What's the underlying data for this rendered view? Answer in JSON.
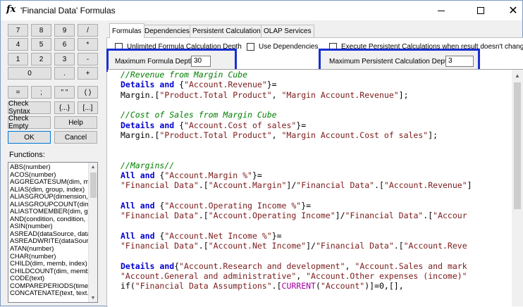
{
  "window": {
    "icon": "fx",
    "title": "'Financial Data' Formulas",
    "min_symbol": "",
    "close_symbol": "✕"
  },
  "keypad": {
    "row1": [
      "7",
      "8",
      "9",
      "/"
    ],
    "row2": [
      "4",
      "5",
      "6",
      "*"
    ],
    "row3": [
      "1",
      "2",
      "3",
      "-"
    ],
    "row4": [
      "0",
      ".",
      "+"
    ],
    "row5": [
      "=",
      ";",
      "\" \"",
      "( )"
    ],
    "check_syntax": "Check Syntax",
    "braces": "{...}",
    "brackets": "[...]",
    "check_empty": "Check Empty",
    "help": "Help",
    "ok": "OK",
    "cancel": "Cancel"
  },
  "functions": {
    "label": "Functions:",
    "items": [
      "ABS(number)",
      "ACOS(number)",
      "AGGREGATESUM(dim, me",
      "ALIAS(dim, group, index)",
      "ALIASGROUP(dimension, i",
      "ALIASGROUPCOUNT(dim",
      "ALIASTOMEMBER(dim, gr",
      "AND(condition, condition, .",
      "ASIN(number)",
      "ASREAD(dataSource, data",
      "ASREADWRITE(dataSourc",
      "ATAN(number)",
      "CHAR(number)",
      "CHILD(dim, memb, index)",
      "CHILDCOUNT(dim, memb)",
      "CODE(text)",
      "COMPAREPERIODS(timeD",
      "CONCATENATE(text, text..."
    ]
  },
  "tabs": [
    "Formulas",
    "Dependencies",
    "Persistent Calculations",
    "OLAP Services"
  ],
  "options": {
    "unlimited_depth": "Unlimited Formula Calculation Depth",
    "use_dependencies": "Use Dependencies",
    "execute_persistent": "Execute Persistent Calculations when result doesn't change",
    "max_formula_depth_label": "Maximum Formula Depth:",
    "max_formula_depth_value": "30",
    "max_persistent_depth_label": "Maximum Persistent Calculation Depth:",
    "max_persistent_depth_value": "3"
  },
  "code_lines": [
    [
      [
        "cm",
        "//Revenue from Margin Cube"
      ]
    ],
    [
      [
        "kw",
        "Details"
      ],
      [
        "pl",
        " "
      ],
      [
        "kw",
        "and"
      ],
      [
        "pl",
        " {"
      ],
      [
        "st",
        "\"Account.Revenue\""
      ],
      [
        "pl",
        "}="
      ]
    ],
    [
      [
        "pl",
        "Margin.["
      ],
      [
        "st",
        "\"Product.Total Product\""
      ],
      [
        "pl",
        ", "
      ],
      [
        "st",
        "\"Margin Account.Revenue\""
      ],
      [
        "pl",
        "];"
      ]
    ],
    [],
    [
      [
        "cm",
        "//Cost of Sales from Margin Cube"
      ]
    ],
    [
      [
        "kw",
        "Details"
      ],
      [
        "pl",
        " "
      ],
      [
        "kw",
        "and"
      ],
      [
        "pl",
        " {"
      ],
      [
        "st",
        "\"Account.Cost of sales\""
      ],
      [
        "pl",
        "}="
      ]
    ],
    [
      [
        "pl",
        "Margin.["
      ],
      [
        "st",
        "\"Product.Total Product\""
      ],
      [
        "pl",
        ", "
      ],
      [
        "st",
        "\"Margin Account.Cost of sales\""
      ],
      [
        "pl",
        "];"
      ]
    ],
    [],
    [],
    [
      [
        "cm",
        "//Margins//"
      ]
    ],
    [
      [
        "kw",
        "All"
      ],
      [
        "pl",
        " "
      ],
      [
        "kw",
        "and"
      ],
      [
        "pl",
        " {"
      ],
      [
        "st",
        "\"Account.Margin %\""
      ],
      [
        "pl",
        "}="
      ]
    ],
    [
      [
        "st",
        "\"Financial Data\""
      ],
      [
        "pl",
        ".["
      ],
      [
        "st",
        "\"Account.Margin\""
      ],
      [
        "pl",
        "]/"
      ],
      [
        "st",
        "\"Financial Data\""
      ],
      [
        "pl",
        ".["
      ],
      [
        "st",
        "\"Account.Revenue\""
      ],
      [
        "pl",
        "]"
      ]
    ],
    [],
    [
      [
        "kw",
        "All"
      ],
      [
        "pl",
        " "
      ],
      [
        "kw",
        "and"
      ],
      [
        "pl",
        " {"
      ],
      [
        "st",
        "\"Account.Operating Income %\""
      ],
      [
        "pl",
        "}="
      ]
    ],
    [
      [
        "st",
        "\"Financial Data\""
      ],
      [
        "pl",
        ".["
      ],
      [
        "st",
        "\"Account.Operating Income\""
      ],
      [
        "pl",
        "]/"
      ],
      [
        "st",
        "\"Financial Data\""
      ],
      [
        "pl",
        ".["
      ],
      [
        "st",
        "\"Accour"
      ]
    ],
    [],
    [
      [
        "kw",
        "All"
      ],
      [
        "pl",
        " "
      ],
      [
        "kw",
        "and"
      ],
      [
        "pl",
        " {"
      ],
      [
        "st",
        "\"Account.Net Income %\""
      ],
      [
        "pl",
        "}="
      ]
    ],
    [
      [
        "st",
        "\"Financial Data\""
      ],
      [
        "pl",
        ".["
      ],
      [
        "st",
        "\"Account.Net Income\""
      ],
      [
        "pl",
        "]/"
      ],
      [
        "st",
        "\"Financial Data\""
      ],
      [
        "pl",
        ".["
      ],
      [
        "st",
        "\"Account.Reve"
      ]
    ],
    [],
    [
      [
        "kw",
        "Details"
      ],
      [
        "pl",
        " "
      ],
      [
        "kw",
        "and"
      ],
      [
        "pl",
        "{"
      ],
      [
        "st",
        "\"Account.Research and development\""
      ],
      [
        "pl",
        ", "
      ],
      [
        "st",
        "\"Account.Sales and mark"
      ]
    ],
    [
      [
        "st",
        "\"Account.General and administrative\""
      ],
      [
        "pl",
        ", "
      ],
      [
        "st",
        "\"Account.Other expenses (income)\""
      ]
    ],
    [
      [
        "pl",
        "if("
      ],
      [
        "st",
        "\"Financial Data Assumptions\""
      ],
      [
        "pl",
        ".["
      ],
      [
        "fn",
        "CURRENT"
      ],
      [
        "pl",
        "("
      ],
      [
        "st",
        "\"Account\""
      ],
      [
        "pl",
        ")]=0,[],"
      ]
    ]
  ],
  "colors": {
    "keyword": "#0000d0",
    "comment": "#008000",
    "string": "#7a1a1a",
    "function": "#a000a0",
    "highlight_box": "#1a2fd0"
  }
}
